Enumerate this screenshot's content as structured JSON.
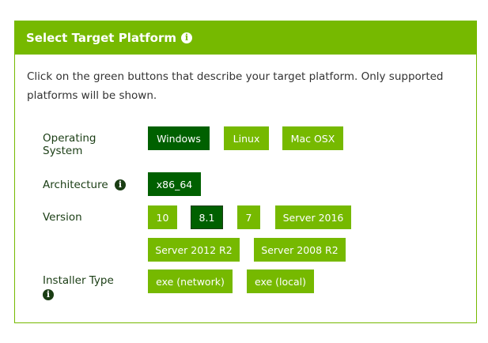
{
  "header": {
    "title": "Select Target Platform",
    "info_icon": "info-icon"
  },
  "description": "Click on the green buttons that describe your target platform. Only supported platforms will be shown.",
  "rows": {
    "os": {
      "label": "Operating System",
      "options": [
        "Windows",
        "Linux",
        "Mac OSX"
      ],
      "selected": "Windows"
    },
    "architecture": {
      "label": "Architecture",
      "options": [
        "x86_64"
      ],
      "selected": "x86_64"
    },
    "version": {
      "label": "Version",
      "options": [
        "10",
        "8.1",
        "7",
        "Server 2016",
        "Server 2012 R2",
        "Server 2008 R2"
      ],
      "selected": "8.1"
    },
    "installer": {
      "label": "Installer Type",
      "options": [
        "exe (network)",
        "exe (local)"
      ],
      "selected": ""
    }
  },
  "colors": {
    "accent": "#76b900",
    "selected": "#006000",
    "label": "#1a3d14"
  }
}
